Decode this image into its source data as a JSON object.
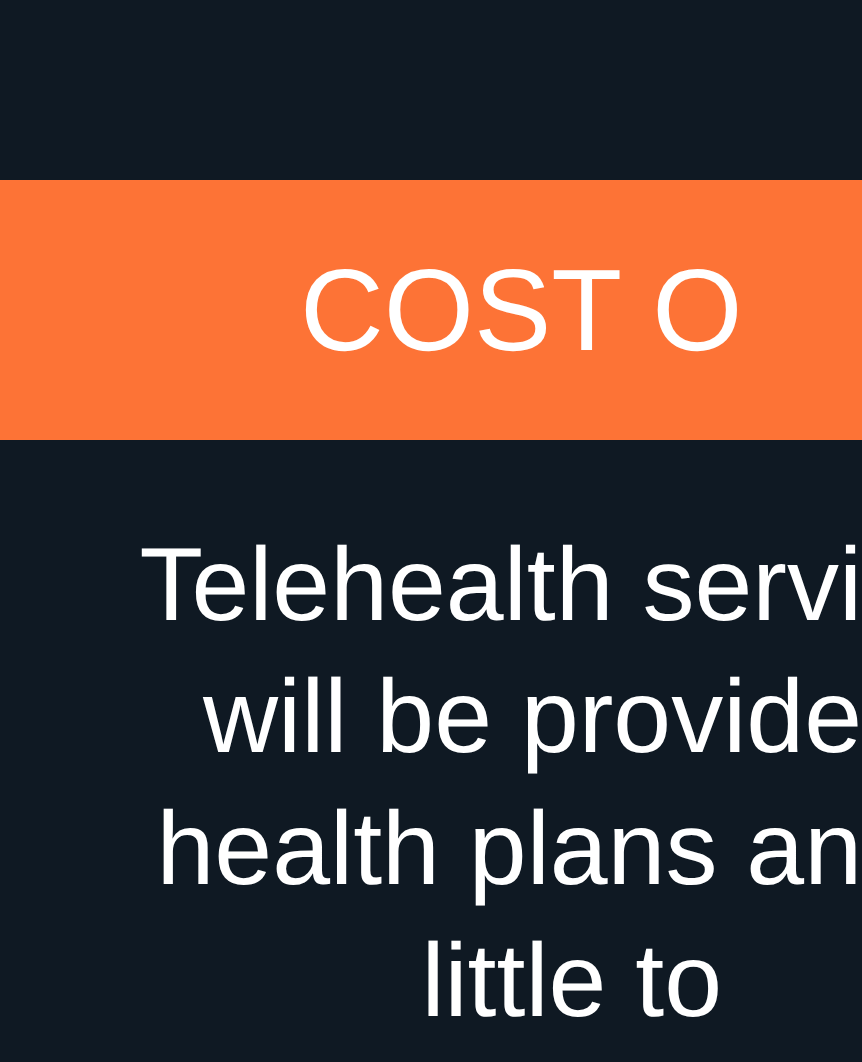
{
  "banner": {
    "title": "COST O"
  },
  "body": {
    "lines": [
      "Telehealth servi",
      "will be provide",
      "health plans an",
      "little to"
    ]
  }
}
